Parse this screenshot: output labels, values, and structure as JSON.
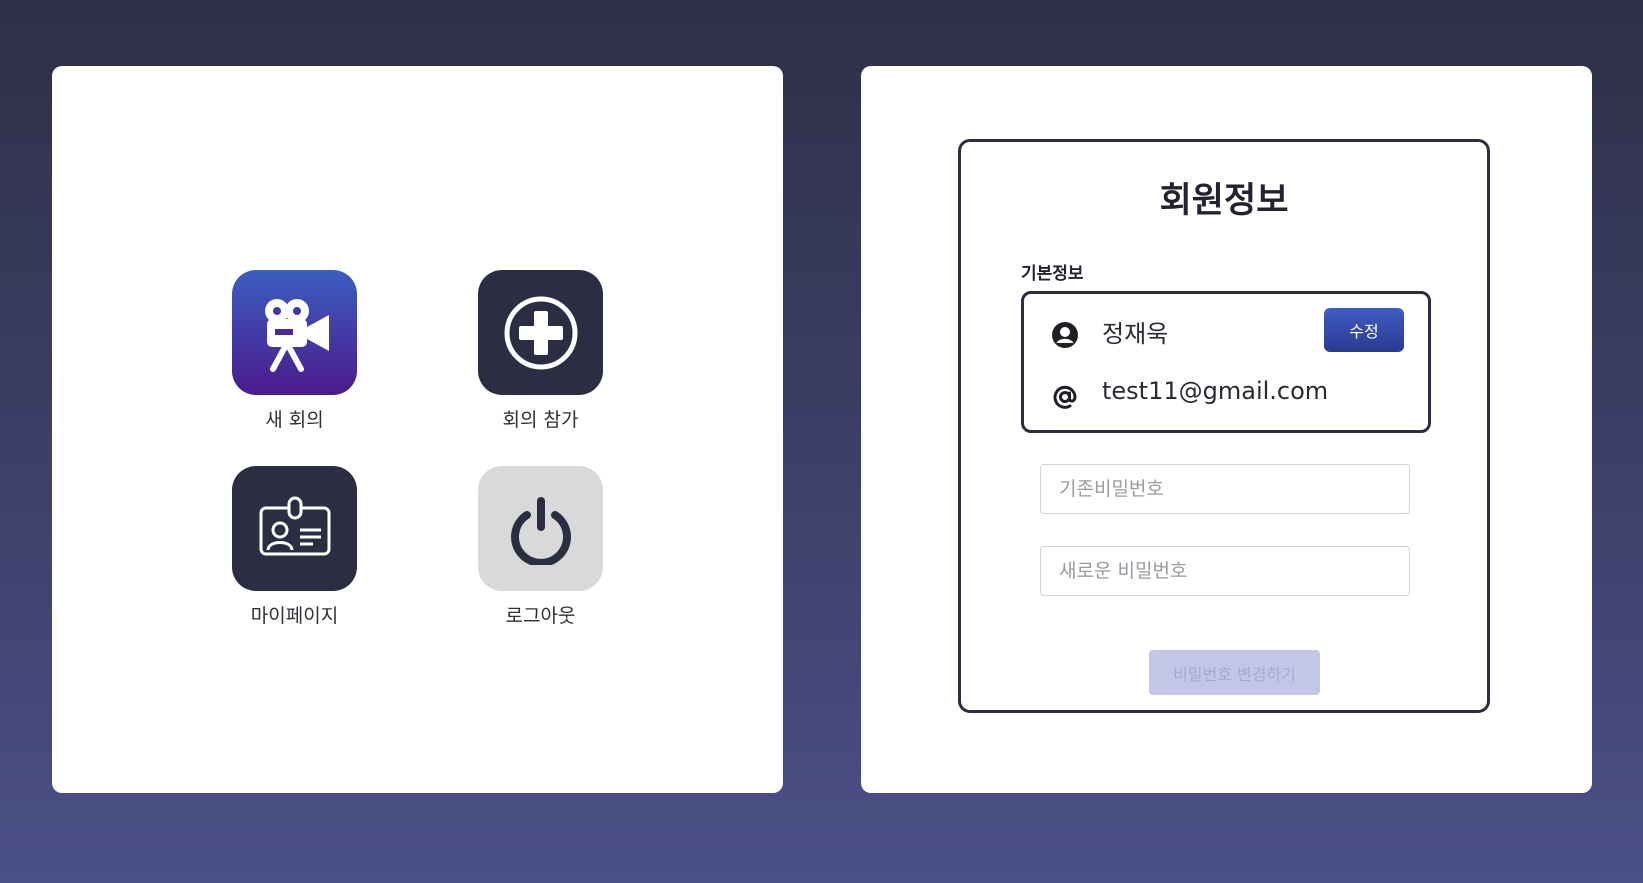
{
  "menu": {
    "items": [
      {
        "label": "새 회의",
        "icon": "video-camera-icon"
      },
      {
        "label": "회의 참가",
        "icon": "plus-circle-icon"
      },
      {
        "label": "마이페이지",
        "icon": "id-card-icon"
      },
      {
        "label": "로그아웃",
        "icon": "power-icon"
      }
    ]
  },
  "profile": {
    "title": "회원정보",
    "section_label": "기본정보",
    "name": "정재욱",
    "email": "test11@gmail.com",
    "edit_label": "수정",
    "current_password_placeholder": "기존비밀번호",
    "new_password_placeholder": "새로운 비밀번호",
    "change_password_label": "비밀번호 변경하기"
  },
  "colors": {
    "accent": "#3a4fb0",
    "dark_tile": "#2b2d42",
    "disabled_button": "#c3c6e6"
  }
}
